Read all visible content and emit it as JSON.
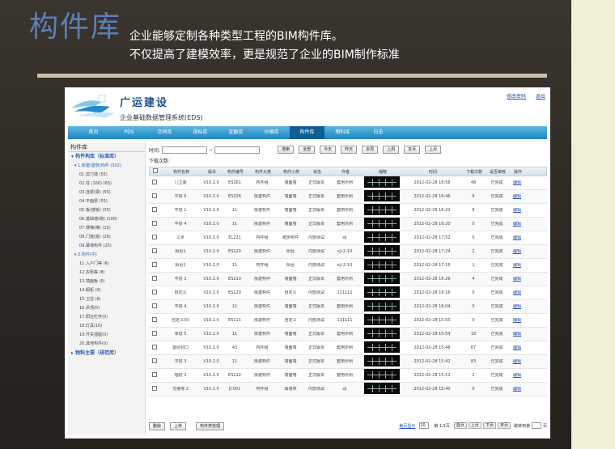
{
  "slide": {
    "title": "构件库",
    "subtitle_line1": "企业能够定制各种类型工程的BIM构件库。",
    "subtitle_line2": "不仅提高了建模效率，更是规范了企业的BIM制作标准"
  },
  "app": {
    "company": "广运建设",
    "system_name": "企业基础数据管理系统(EDS)",
    "top_links": [
      "修改密码",
      "退出"
    ]
  },
  "nav": [
    "首页",
    "PDS",
    "合同库",
    "指标库",
    "定额库",
    "价格库",
    "构件库",
    "物料库",
    "日志"
  ],
  "nav_active": 6,
  "sidebar": {
    "title": "构件库",
    "root1": "▾ 构件构库（标准库）",
    "group1": "▾ 1.房建(建筑)构件 (302)",
    "group1_items": [
      "01.剪力墙 (55)",
      "02.柱 (100) (65)",
      "03.连梁(梁) (55)",
      "04.平面梁 (55)",
      "05.板(楼板) (35)",
      "06.基础墙(砌) (100)",
      "07.楼梯(梯) (15)",
      "08.门窗(窗) (26)",
      "09.幕墙构件 (25)"
    ],
    "group2": "▾ 2.构件(中)",
    "group2_items": [
      "11.入户门等 (6)",
      "12.衣柜等 (8)",
      "13.墙面板 (0)",
      "14.橱柜 (0)",
      "15.卫浴 (6)",
      "16.吊顶(0)",
      "17.阳台栏杆(0)",
      "18.灯具(10)",
      "19.开关插座(0)",
      "20.其他构件(0)"
    ],
    "root2": "▸ 物料主要（规范库）"
  },
  "filter": {
    "label": "时间:",
    "sep": "~",
    "buttons": [
      "搜索",
      "全部",
      "今天",
      "昨天",
      "本周",
      "上周",
      "本月",
      "上月"
    ]
  },
  "download_label": "下载次数:",
  "table": {
    "headers": [
      "",
      "构件名称",
      "版本",
      "构件编号",
      "构件大类",
      "构件小类",
      "状态",
      "作者",
      "缩略",
      "时间",
      "下载次数",
      "是否审核",
      "操作"
    ],
    "rows": [
      [
        "",
        "门立装",
        "V10.2.0",
        "ES161",
        "构件组",
        "墙面墙",
        "正式版本",
        "套用示例",
        "",
        "2012-02-28 16:58",
        "48",
        "已完成",
        "编辑"
      ],
      [
        "",
        "平层 6",
        "V10.2.0",
        "ES326",
        "房建构件",
        "墙面墙",
        "正式版本",
        "套用示例",
        "",
        "2012-02-28 16:46",
        "6",
        "已完成",
        "编辑"
      ],
      [
        "",
        "平层 1",
        "V10.2.0",
        "11",
        "房建构件",
        "墙面墙",
        "正式版本",
        "套用示例",
        "",
        "2012-02-28 16:22",
        "6",
        "已完成",
        "编辑"
      ],
      [
        "",
        "平层 4",
        "V10.2.0",
        "11",
        "房建构件",
        "墙面墙",
        "正式版本",
        "套用示例",
        "",
        "2012-02-28 16:20",
        "0",
        "已完成",
        "编辑"
      ],
      [
        "",
        "三步",
        "V10.2.0",
        "EL221",
        "构件组",
        "踏步构件",
        "内部测试",
        "sjl",
        "",
        "2012-02-28 17:52",
        "0",
        "已完成",
        "编辑"
      ],
      [
        "",
        "阳台1",
        "V10.2.0",
        "ES120",
        "房建构件",
        "阳台",
        "内部测试",
        "sjl-2-10",
        "",
        "2012-02-28 17:24",
        "2",
        "已完成",
        "编辑"
      ],
      [
        "",
        "阳台1",
        "V10.2.0",
        "11",
        "构件组",
        "阳台",
        "内部测试",
        "sjl-2-10",
        "",
        "2012-02-28 17:16",
        "1",
        "已完成",
        "编辑"
      ],
      [
        "",
        "平层 2",
        "V10.2.0",
        "ES210",
        "房建构件",
        "墙面墙",
        "正式版本",
        "套用示例",
        "",
        "2012-02-28 16:26",
        "4",
        "已完成",
        "编辑"
      ],
      [
        "",
        "自定义",
        "V10.2.0",
        "ES120",
        "房建构件",
        "自定义",
        "内部测试",
        "111111",
        "",
        "2012-02-28 16:16",
        "0",
        "已完成",
        "编辑"
      ],
      [
        "",
        "平层 4",
        "V10.2.0",
        "11",
        "房建构件",
        "墙面墙",
        "正式版本",
        "套用示例",
        "",
        "2012-02-28 16:04",
        "0",
        "已完成",
        "编辑"
      ],
      [
        "",
        "自定义(0)",
        "V10.2.0",
        "ES111",
        "房建构件",
        "自定义",
        "内部测试",
        "111111",
        "",
        "2012-02-28 15:55",
        "0",
        "已完成",
        "编辑"
      ],
      [
        "",
        "单层 5",
        "V10.2.0",
        "11",
        "房建构件",
        "墙面墙",
        "正式版本",
        "套用示例",
        "",
        "2012-02-28 15:54",
        "18",
        "已完成",
        "编辑"
      ],
      [
        "",
        "首层洞口",
        "V10.2.0",
        "43",
        "构件组",
        "墙面墙",
        "正式版本",
        "套用示例",
        "",
        "2012-02-28 15:48",
        "67",
        "已完成",
        "编辑"
      ],
      [
        "",
        "平层 3",
        "V10.2.0",
        "11",
        "房建构件",
        "墙面墙",
        "正式版本",
        "套用示例",
        "",
        "2012-02-28 15:42",
        "83",
        "已完成",
        "编辑"
      ],
      [
        "",
        "轴层 2",
        "V10.2.0",
        "ES112",
        "房建构件",
        "墙面墙",
        "正式版本",
        "套用示例",
        "",
        "2012-02-28 15:12",
        "2",
        "已完成",
        "编辑"
      ],
      [
        "",
        "交接墙 2",
        "V10.2.0",
        "JC001",
        "构件组",
        "幕墙类",
        "内部测试",
        "sjl",
        "",
        "2012-02-28 15:40",
        "0",
        "已完成",
        "编辑"
      ]
    ]
  },
  "bottom": {
    "buttons": [
      "删除",
      "上传",
      "构件类管理"
    ],
    "pager_left": "每页显示",
    "page_size": "20",
    "pager_mid": "第 1/1页",
    "pager_btns": [
      "首页",
      "上页",
      "下页",
      "末页"
    ],
    "goto": "跳转到第",
    "page_unit": "页"
  }
}
